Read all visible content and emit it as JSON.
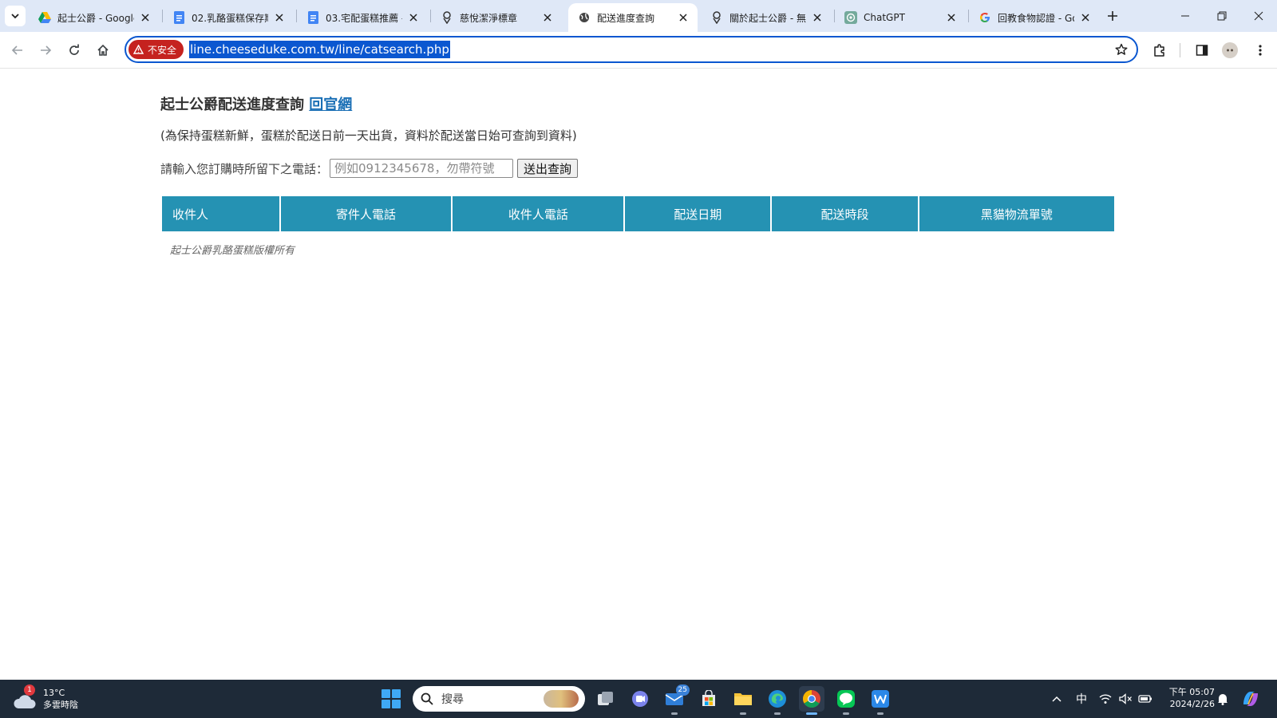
{
  "browser": {
    "tabs": [
      {
        "title": "起士公爵 - Google",
        "icon": "google-drive-icon",
        "active": false
      },
      {
        "title": "02.乳酪蛋糕保存期",
        "icon": "google-docs-icon",
        "active": false
      },
      {
        "title": "03.宅配蛋糕推薦 -",
        "icon": "google-docs-icon",
        "active": false
      },
      {
        "title": "慈悅潔淨標章",
        "icon": "site-logo-icon",
        "active": false
      },
      {
        "title": "配送進度查詢",
        "icon": "globe-icon",
        "active": true
      },
      {
        "title": "關於起士公爵 - 無",
        "icon": "site-logo-icon",
        "active": false
      },
      {
        "title": "ChatGPT",
        "icon": "chatgpt-icon",
        "active": false
      },
      {
        "title": "回教食物認證 - Go",
        "icon": "google-icon",
        "active": false
      }
    ],
    "security_label": "不安全",
    "url": "line.cheeseduke.com.tw/line/catsearch.php"
  },
  "page": {
    "heading": "起士公爵配送進度查詢",
    "home_link": "回官網",
    "notice": "(為保持蛋糕新鮮，蛋糕於配送日前一天出貨，資料於配送當日始可查詢到資料)",
    "phone_label": "請輸入您訂購時所留下之電話：",
    "phone_placeholder": "例如0912345678，勿帶符號",
    "phone_value": "",
    "submit_label": "送出查詢",
    "table_headers": [
      "收件人",
      "寄件人電話",
      "收件人電話",
      "配送日期",
      "配送時段",
      "黑貓物流單號"
    ],
    "copyright": "起士公爵乳酪蛋糕版權所有"
  },
  "taskbar": {
    "weather_badge": "1",
    "temperature": "13°C",
    "weather_desc": "多雲時陰",
    "search_label": "搜尋",
    "mail_badge": "25",
    "ime_label": "中",
    "time": "下午 05:07",
    "date": "2024/2/26"
  },
  "colors": {
    "table_header_bg": "#2592b3",
    "omnibox_border": "#0b57d0",
    "security_chip": "#c5221f",
    "link": "#1a6fb5",
    "taskbar_bg": "#1e2a38"
  }
}
